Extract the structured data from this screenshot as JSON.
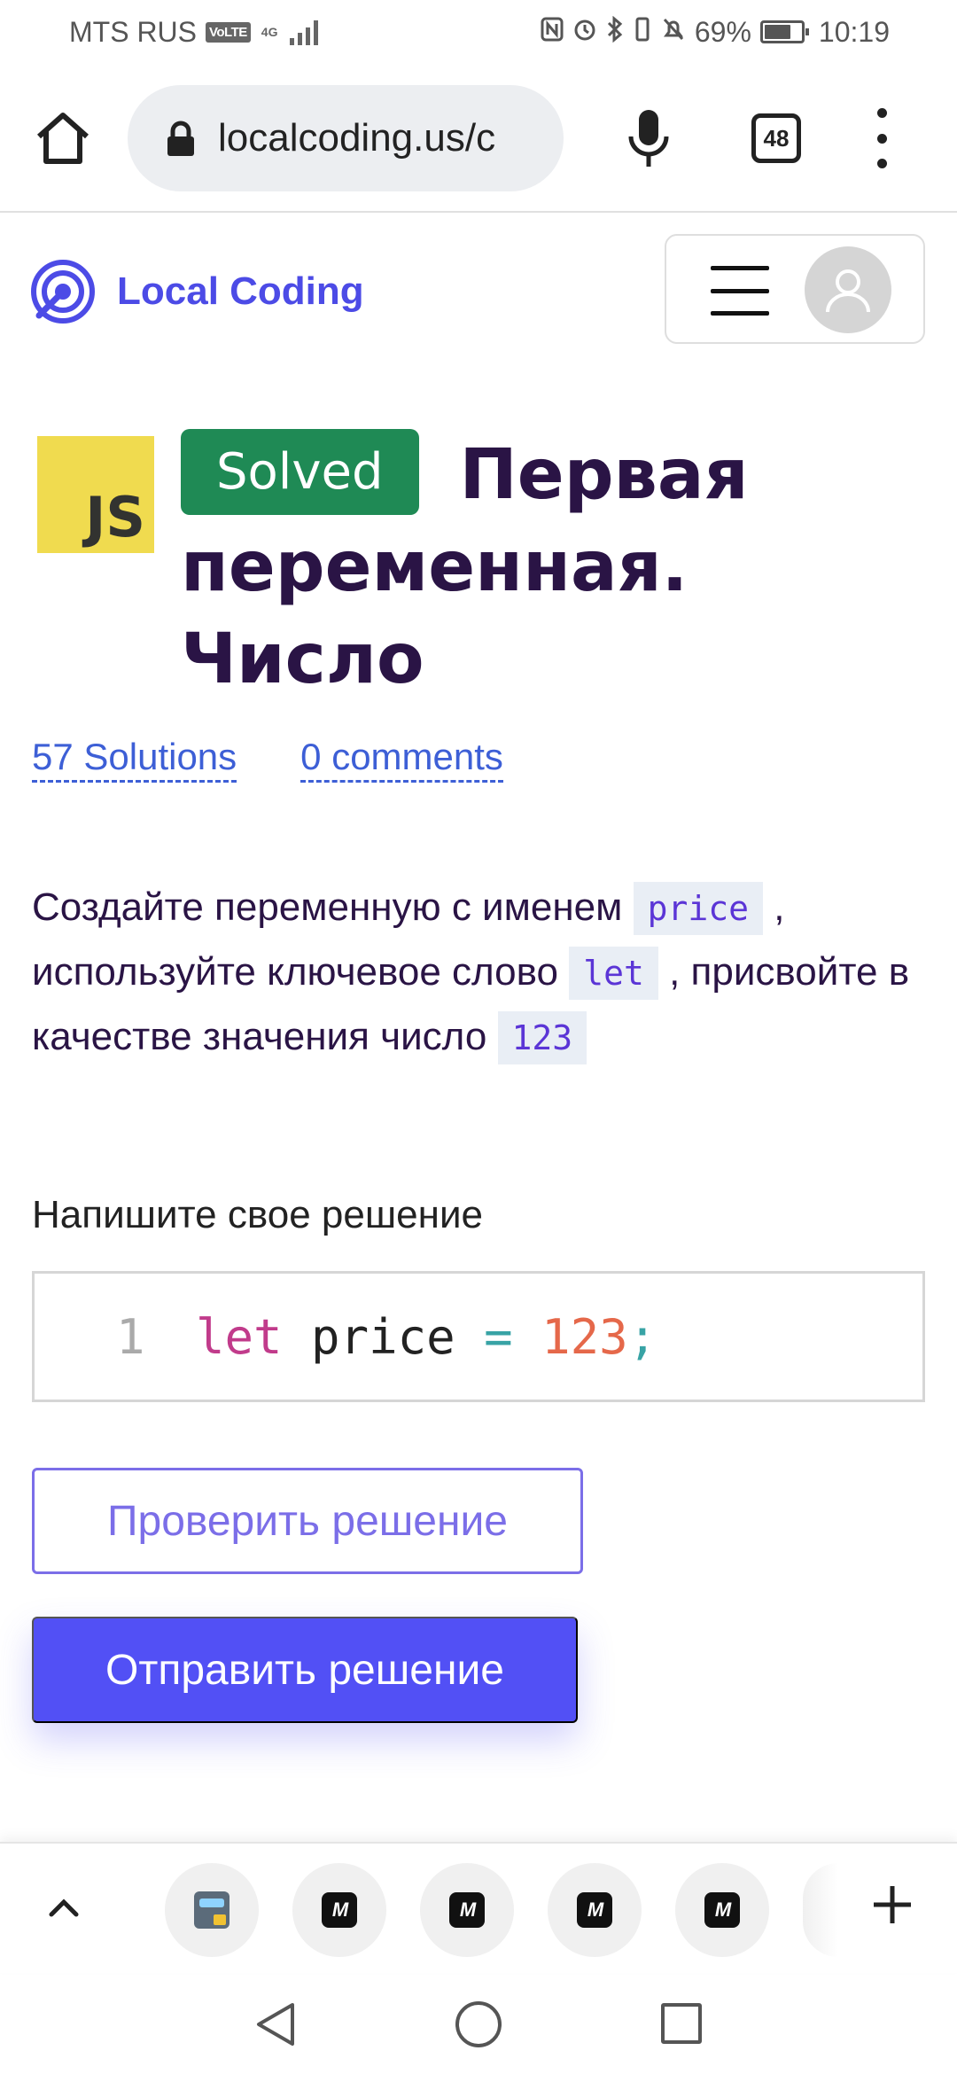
{
  "status_bar": {
    "carrier": "MTS RUS",
    "volte": "VoLTE",
    "network": "4G",
    "battery": "69%",
    "battery_level": 0.69,
    "time": "10:19"
  },
  "browser": {
    "url": "localcoding.us/c",
    "tab_count": "48",
    "icons": [
      "home-icon",
      "lock-icon",
      "mic-icon",
      "tabs-icon",
      "more-vert-icon"
    ]
  },
  "site": {
    "brand_name": "Local Coding",
    "brand_color": "#4c4be6"
  },
  "task": {
    "language_badge": "JS",
    "status": "Solved",
    "status_color": "#1f8a55",
    "title": "Первая переменная. Число",
    "solutions_link": "57 Solutions",
    "comments_link": "0 comments",
    "description": {
      "part1": "Создайте переменную с именем ",
      "code1": "price",
      "part2": " , используйте ключевое слово ",
      "code2": "let",
      "part3": " , присвойте в качестве значения число ",
      "code3": "123"
    }
  },
  "editor": {
    "label": "Напишите свое решение",
    "line_number": "1",
    "keyword": "let",
    "identifier": " price ",
    "operator": "=",
    "number": " 123",
    "punct": ";"
  },
  "actions": {
    "check_label": "Проверить решение",
    "submit_label": "Отправить решение",
    "accent_color": "#5250f5"
  },
  "tab_strip": {
    "thumb_labels": [
      "",
      "M",
      "M",
      "M",
      "M"
    ]
  }
}
